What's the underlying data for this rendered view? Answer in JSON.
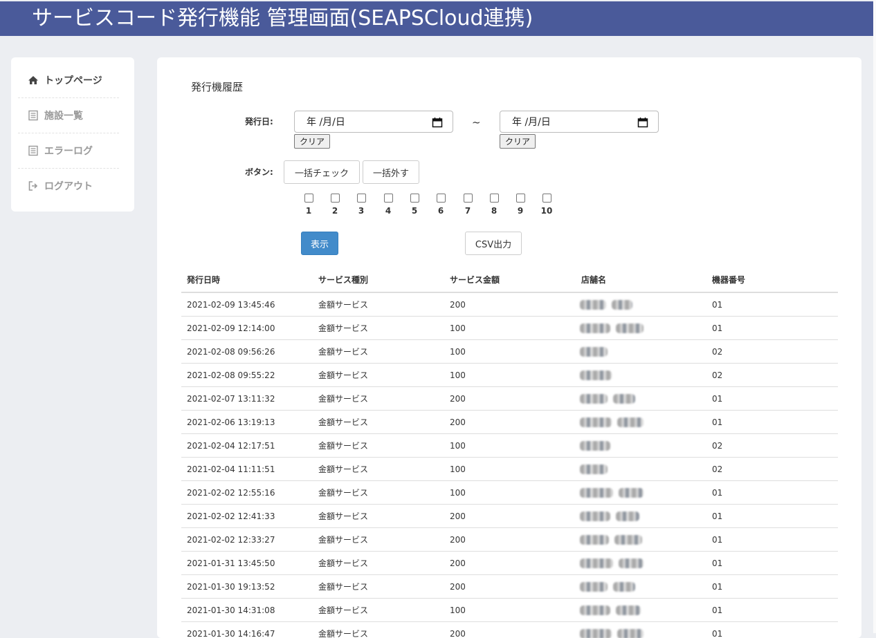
{
  "header": {
    "title": "サービスコード発行機能 管理画面(SEAPSCloud連携)"
  },
  "sidebar": {
    "items": [
      {
        "label": "トップページ",
        "icon": "home-icon",
        "active": true
      },
      {
        "label": "施設一覧",
        "icon": "list-icon",
        "active": false
      },
      {
        "label": "エラーログ",
        "icon": "list-icon",
        "active": false
      },
      {
        "label": "ログアウト",
        "icon": "logout-icon",
        "active": false
      }
    ]
  },
  "main": {
    "section_title": "発行機履歴",
    "filters": {
      "date_label": "発行日:",
      "date_from_placeholder": "年 /月/日",
      "date_to_placeholder": "年 /月/日",
      "clear_label": "クリア",
      "range_separator": "~",
      "button_label": "ボタン:",
      "check_all_label": "一括チェック",
      "uncheck_all_label": "一括外す",
      "checkboxes": [
        "1",
        "2",
        "3",
        "4",
        "5",
        "6",
        "7",
        "8",
        "9",
        "10"
      ]
    },
    "show_button": "表示",
    "csv_button": "CSV出力",
    "table": {
      "headers": [
        "発行日時",
        "サービス種別",
        "サービス金額",
        "店舗名",
        "機器番号"
      ],
      "rows": [
        {
          "datetime": "2021-02-09 13:45:46",
          "type": "金額サービス",
          "amount": "200",
          "device": "01"
        },
        {
          "datetime": "2021-02-09 12:14:00",
          "type": "金額サービス",
          "amount": "100",
          "device": "01"
        },
        {
          "datetime": "2021-02-08 09:56:26",
          "type": "金額サービス",
          "amount": "100",
          "device": "02"
        },
        {
          "datetime": "2021-02-08 09:55:22",
          "type": "金額サービス",
          "amount": "100",
          "device": "02"
        },
        {
          "datetime": "2021-02-07 13:11:32",
          "type": "金額サービス",
          "amount": "200",
          "device": "01"
        },
        {
          "datetime": "2021-02-06 13:19:13",
          "type": "金額サービス",
          "amount": "200",
          "device": "01"
        },
        {
          "datetime": "2021-02-04 12:17:51",
          "type": "金額サービス",
          "amount": "100",
          "device": "02"
        },
        {
          "datetime": "2021-02-04 11:11:51",
          "type": "金額サービス",
          "amount": "100",
          "device": "02"
        },
        {
          "datetime": "2021-02-02 12:55:16",
          "type": "金額サービス",
          "amount": "100",
          "device": "01"
        },
        {
          "datetime": "2021-02-02 12:41:33",
          "type": "金額サービス",
          "amount": "200",
          "device": "01"
        },
        {
          "datetime": "2021-02-02 12:33:27",
          "type": "金額サービス",
          "amount": "200",
          "device": "01"
        },
        {
          "datetime": "2021-01-31 13:45:50",
          "type": "金額サービス",
          "amount": "200",
          "device": "01"
        },
        {
          "datetime": "2021-01-30 19:13:52",
          "type": "金額サービス",
          "amount": "200",
          "device": "01"
        },
        {
          "datetime": "2021-01-30 14:31:08",
          "type": "金額サービス",
          "amount": "100",
          "device": "01"
        },
        {
          "datetime": "2021-01-30 14:16:47",
          "type": "金額サービス",
          "amount": "200",
          "device": "01"
        }
      ]
    }
  },
  "colors": {
    "header_bg": "#4a5a9a",
    "page_bg": "#eceef2",
    "primary_button": "#428bca"
  }
}
